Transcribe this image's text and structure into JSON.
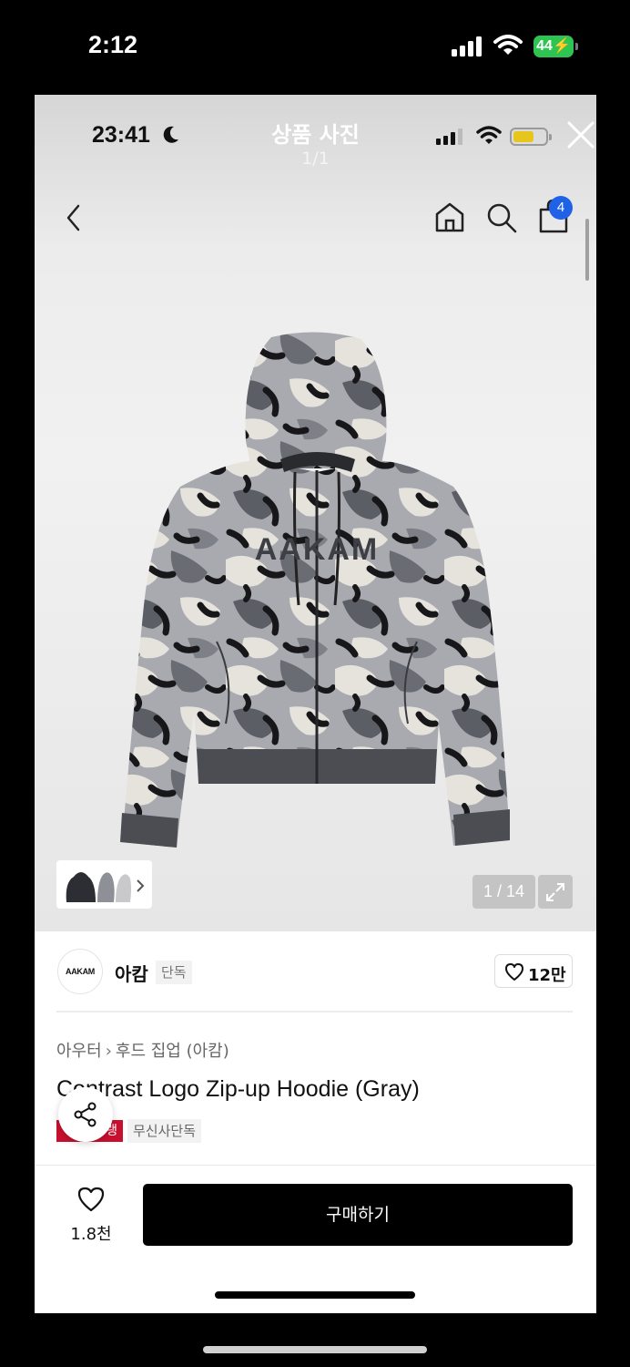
{
  "device_status": {
    "time": "2:12",
    "battery": "44"
  },
  "viewer": {
    "title": "상품 사진",
    "counter": "1/1"
  },
  "inner_status": {
    "time": "23:41"
  },
  "nav": {
    "cart_count": "4"
  },
  "gallery": {
    "counter": "1 / 14",
    "product_logo_text": "AAKAM"
  },
  "brand": {
    "logo_text": "AAKAM",
    "name": "아캄",
    "tag": "단독",
    "likes": "12만"
  },
  "breadcrumb": {
    "category": "아우터",
    "subcategory": "후드 집업 (아캄)"
  },
  "product": {
    "title": "Contrast Logo Zip-up Hoodie (Gray)",
    "badge_red": "랭",
    "badge_gray": "무신사단독"
  },
  "bottom_bar": {
    "wishlist_count": "1.8천",
    "buy_label": "구매하기"
  },
  "colors": {
    "accent_badge": "#1f62e8",
    "red_badge": "#c8102e",
    "battery_green": "#2ec451",
    "buy_button": "#000000"
  }
}
